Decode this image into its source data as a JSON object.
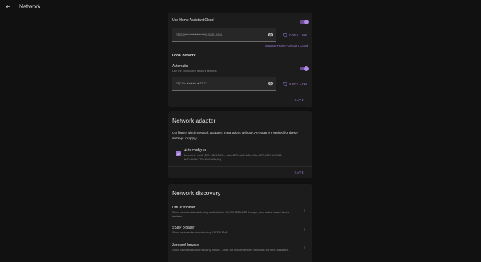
{
  "header": {
    "title": "Network"
  },
  "cloud": {
    "toggle_label": "Use Home Assistant Cloud",
    "url": "https://••••••••••••••••••ui.nabu.casa",
    "copy_label": "COPY LINK",
    "manage_label": "Manage Home Assistant Cloud"
  },
  "local": {
    "heading": "Local network",
    "auto_label": "Automatic",
    "auto_sub": "Use the configured network settings",
    "url": "http://•• • ••• • • ••:8123",
    "copy_label": "COPY LINK",
    "save_label": "SAVE"
  },
  "adapter": {
    "title": "Network adapter",
    "description": "Configure which network adapters integrations will use. A restart is required for these settings to apply.",
    "auto_label": "Auto configure",
    "auto_sub": "Detected: end0 (192.168.1.38/24, fdad:2278:ab9:da5b:cf3e:4577:8522:6bf9/64, fe80::bb9b:7734:f0c8:df5e/64)",
    "save_label": "SAVE"
  },
  "discovery": {
    "title": "Network discovery",
    "items": [
      {
        "title": "DHCP browser",
        "sub": "Show devices detected using methods like DHCP, ARP+PTR lookups, and router-based device trackers."
      },
      {
        "title": "SSDP browser",
        "sub": "Show devices discovered using SSDP/UPnP."
      },
      {
        "title": "Zeroconf browser",
        "sub": "Show devices discovered using mDNS. Does not include devices unknown to Home Assistant."
      }
    ]
  },
  "colors": {
    "accent": "#9c7ad6",
    "background": "#111111",
    "card": "#1c1c1c"
  }
}
